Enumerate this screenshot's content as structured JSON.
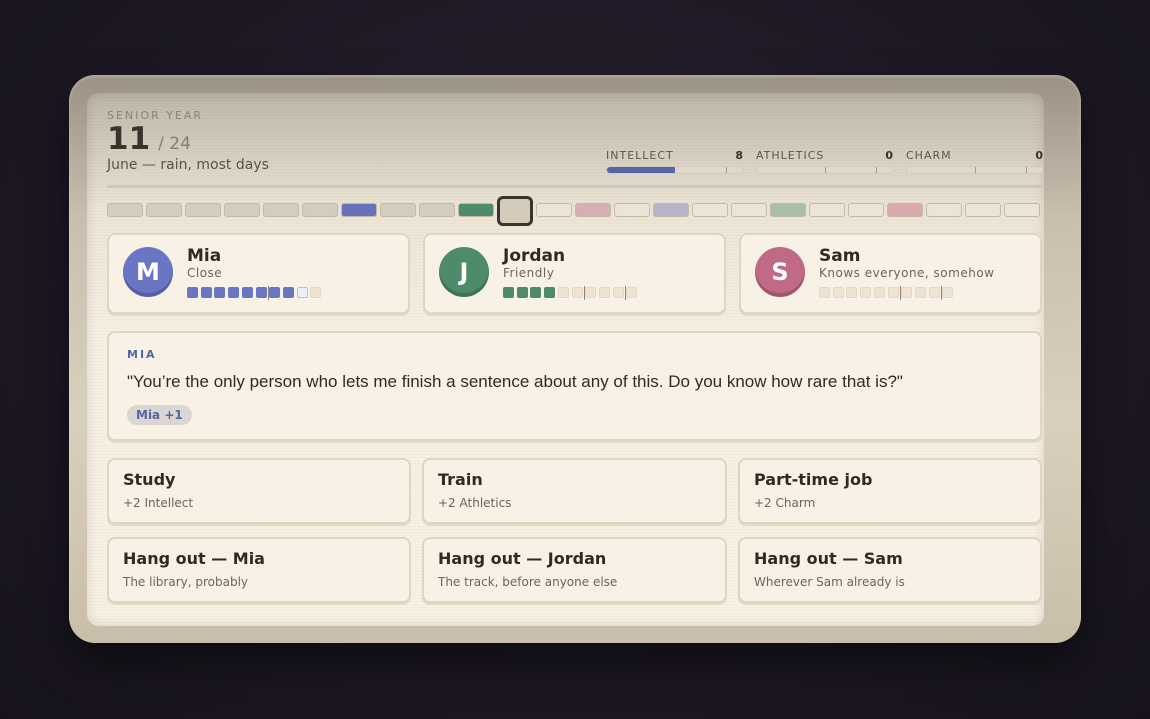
{
  "header": {
    "year": "SENIOR YEAR",
    "day": "11",
    "total": "/ 24",
    "weather": "June — rain, most days"
  },
  "stats": [
    {
      "label": "INTELLECT",
      "value": "8",
      "fill": 0.5,
      "color": "#5664a8"
    },
    {
      "label": "ATHLETICS",
      "value": "0",
      "fill": 0,
      "color": "#4e8b6a"
    },
    {
      "label": "CHARM",
      "value": "0",
      "fill": 0,
      "color": "#c06a86"
    }
  ],
  "timeline": {
    "current_day": 11,
    "days": [
      {
        "color": "#d4ccbe"
      },
      {
        "color": "#d4ccbe"
      },
      {
        "color": "#d4ccbe"
      },
      {
        "color": "#d4ccbe"
      },
      {
        "color": "#d4ccbe"
      },
      {
        "color": "#d4ccbe"
      },
      {
        "color": "#6872bb"
      },
      {
        "color": "#d4ccbe"
      },
      {
        "color": "#d4ccbe"
      },
      {
        "color": "#4e8b6a"
      },
      {
        "color": "#d4ccbe"
      },
      {
        "color": "#ece4d6"
      },
      {
        "color": "#d7aeb1"
      },
      {
        "color": "#ece4d6"
      },
      {
        "color": "#b8b3c6"
      },
      {
        "color": "#ece4d6"
      },
      {
        "color": "#ece4d6"
      },
      {
        "color": "#a9bda9"
      },
      {
        "color": "#ece4d6"
      },
      {
        "color": "#ece4d6"
      },
      {
        "color": "#d9a9ae"
      },
      {
        "color": "#ece4d6"
      },
      {
        "color": "#ece4d6"
      },
      {
        "color": "#ece4d6"
      }
    ]
  },
  "people": [
    {
      "initial": "M",
      "name": "Mia",
      "status": "Close",
      "color": "#6a76c4",
      "level": 8,
      "partial": 1,
      "max": 10,
      "marks": [
        6
      ]
    },
    {
      "initial": "J",
      "name": "Jordan",
      "status": "Friendly",
      "color": "#4e8b6a",
      "level": 4,
      "partial": 0,
      "max": 10,
      "marks": [
        6,
        9
      ]
    },
    {
      "initial": "S",
      "name": "Sam",
      "status": "Knows everyone, somehow",
      "color": "#c06a86",
      "level": 0,
      "partial": 0,
      "max": 10,
      "marks": [
        6,
        9
      ]
    }
  ],
  "dialog": {
    "speaker": "MIA",
    "line": "\"You’re the only person who lets me finish a sentence about any of this. Do you know how rare that is?\"",
    "badge": "Mia +1"
  },
  "actions": [
    {
      "title": "Study",
      "sub": "+2 Intellect"
    },
    {
      "title": "Train",
      "sub": "+2 Athletics"
    },
    {
      "title": "Part-time job",
      "sub": "+2 Charm"
    },
    {
      "title": "Hang out — Mia",
      "sub": "The library, probably"
    },
    {
      "title": "Hang out — Jordan",
      "sub": "The track, before anyone else"
    },
    {
      "title": "Hang out — Sam",
      "sub": "Wherever Sam already is"
    }
  ]
}
